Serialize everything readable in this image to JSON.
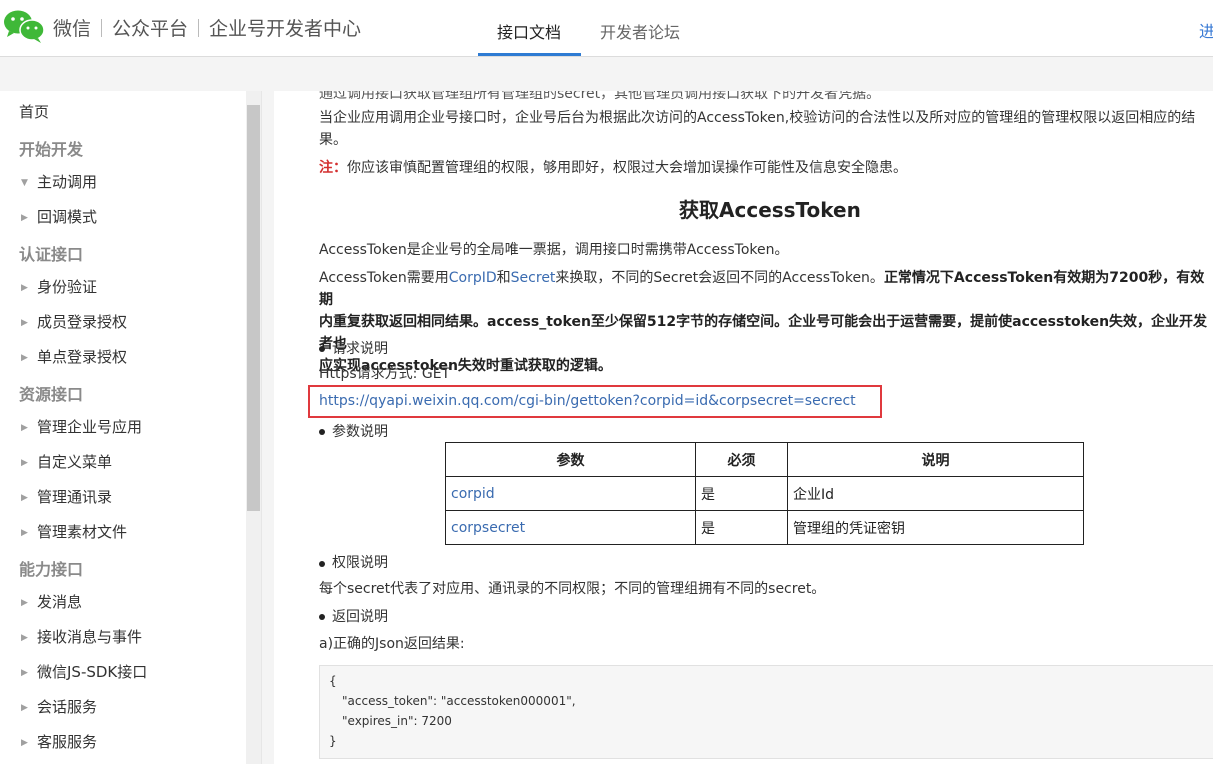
{
  "header": {
    "brand_1": "微信",
    "brand_2": "公众平台",
    "brand_3": "企业号开发者中心",
    "tabs": [
      {
        "label": "接口文档",
        "active": true
      },
      {
        "label": "开发者论坛",
        "active": false
      }
    ],
    "login_label": "进",
    "accent": "#2e7bd3"
  },
  "sidebar": {
    "items": [
      {
        "label": "首页",
        "type": "top"
      },
      {
        "label": "开始开发",
        "type": "section"
      },
      {
        "label": "主动调用",
        "type": "sub",
        "expanded": true
      },
      {
        "label": "回调模式",
        "type": "sub"
      },
      {
        "label": "认证接口",
        "type": "section"
      },
      {
        "label": "身份验证",
        "type": "sub"
      },
      {
        "label": "成员登录授权",
        "type": "sub"
      },
      {
        "label": "单点登录授权",
        "type": "sub"
      },
      {
        "label": "资源接口",
        "type": "section"
      },
      {
        "label": "管理企业号应用",
        "type": "sub"
      },
      {
        "label": "自定义菜单",
        "type": "sub"
      },
      {
        "label": "管理通讯录",
        "type": "sub"
      },
      {
        "label": "管理素材文件",
        "type": "sub"
      },
      {
        "label": "能力接口",
        "type": "section"
      },
      {
        "label": "发消息",
        "type": "sub"
      },
      {
        "label": "接收消息与事件",
        "type": "sub"
      },
      {
        "label": "微信JS-SDK接口",
        "type": "sub"
      },
      {
        "label": "会话服务",
        "type": "sub"
      },
      {
        "label": "客服服务",
        "type": "sub"
      }
    ]
  },
  "content": {
    "cutoff_line": "通过调用接口获取管理组所有管理组的secret，其他管理员调用接口获取下的开发者凭据。",
    "para1": "当企业应用调用企业号接口时，企业号后台为根据此次访问的AccessToken,校验访问的合法性以及所对应的管理组的管理权限以返回相应的结",
    "para1_cont": "果。",
    "note_label": "注：",
    "note_text": "你应该审慎配置管理组的权限，够用即好，权限过大会增加误操作可能性及信息安全隐患。",
    "heading": "获取AccessToken",
    "para2": "AccessToken是企业号的全局唯一票据，调用接口时需携带AccessToken。",
    "para3_a": "AccessToken需要用",
    "para3_link1": "CorpID",
    "para3_b": "和",
    "para3_link2": "Secret",
    "para3_c": "来换取，不同的Secret会返回不同的AccessToken。",
    "para3_bold1": "正常情况下AccessToken有效期为7200秒，有效期",
    "para3_bold2": "内重复获取返回相同结果。access_token至少保留512字节的存储空间。企业号可能会出于运营需要，提前使accesstoken失效，企业开发者也",
    "para3_bold3": "应实现accesstoken失效时重试获取的逻辑。",
    "bullet_request": "请求说明",
    "https_method": "Https请求方式: GET",
    "url": "https://qyapi.weixin.qq.com/cgi-bin/gettoken?corpid=id&corpsecret=secrect",
    "bullet_params": "参数说明",
    "table": {
      "headers": [
        "参数",
        "必须",
        "说明"
      ],
      "rows": [
        [
          "corpid",
          "是",
          "企业Id"
        ],
        [
          "corpsecret",
          "是",
          "管理组的凭证密钥"
        ]
      ]
    },
    "bullet_perm": "权限说明",
    "perm_text": "每个secret代表了对应用、通讯录的不同权限；不同的管理组拥有不同的secret。",
    "bullet_return": "返回说明",
    "return_a": "a)正确的Json返回结果:",
    "code_lines": [
      "{",
      "\"access_token\": \"accesstoken000001\",",
      "\"expires_in\": 7200",
      "}"
    ]
  }
}
